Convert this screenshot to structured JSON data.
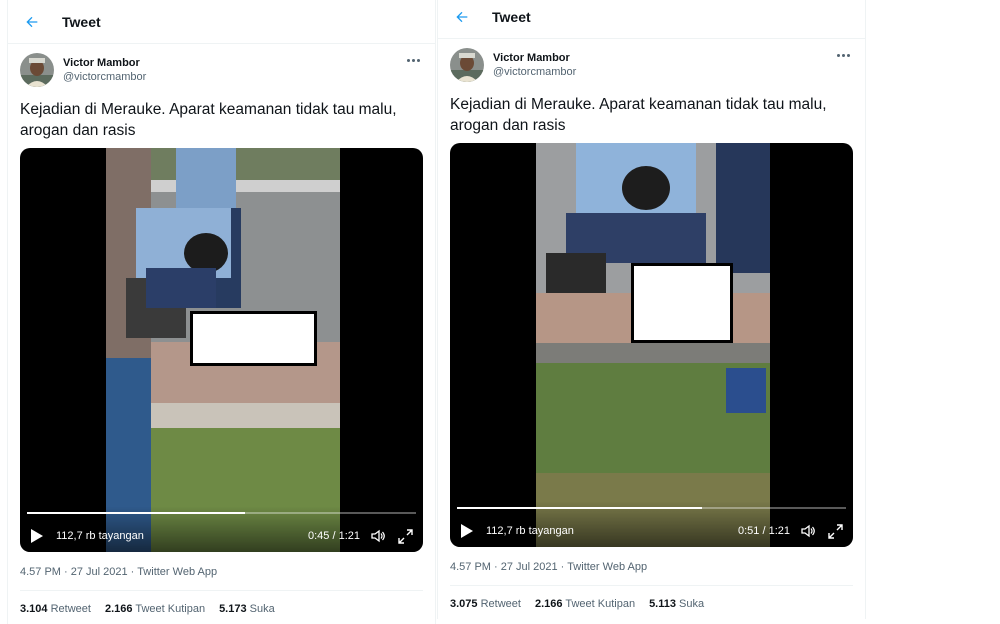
{
  "panels": [
    {
      "header": {
        "title": "Tweet"
      },
      "author": {
        "name": "Victor Mambor",
        "handle": "@victorcmambor"
      },
      "tweet_text": "Kejadian di Merauke. Aparat keamanan tidak tau malu, arogan dan rasis",
      "video": {
        "views_label": "112,7 rb tayangan",
        "time": "0:45 / 1:21",
        "progress_fraction": 0.56
      },
      "meta": "4.57 PM · 27 Jul 2021 · Twitter Web App",
      "stats": {
        "retweets_count": "3.104",
        "retweets_label": "Retweet",
        "quotes_count": "2.166",
        "quotes_label": "Tweet Kutipan",
        "likes_count": "5.173",
        "likes_label": "Suka"
      }
    },
    {
      "header": {
        "title": "Tweet"
      },
      "author": {
        "name": "Victor Mambor",
        "handle": "@victorcmambor"
      },
      "tweet_text": "Kejadian di Merauke. Aparat keamanan tidak tau malu, arogan dan rasis",
      "video": {
        "views_label": "112,7 rb tayangan",
        "time": "0:51 / 1:21",
        "progress_fraction": 0.63
      },
      "meta": "4.57 PM · 27 Jul 2021 · Twitter Web App",
      "stats": {
        "retweets_count": "3.075",
        "retweets_label": "Retweet",
        "quotes_count": "2.166",
        "quotes_label": "Tweet Kutipan",
        "likes_count": "5.113",
        "likes_label": "Suka"
      }
    }
  ],
  "colors": {
    "accent": "#1d9bf0",
    "text": "#0f1419",
    "secondary": "#536471",
    "divider": "#eff3f4"
  },
  "icons": [
    "back-arrow-icon",
    "more-icon",
    "play-icon",
    "volume-icon",
    "fullscreen-icon"
  ]
}
